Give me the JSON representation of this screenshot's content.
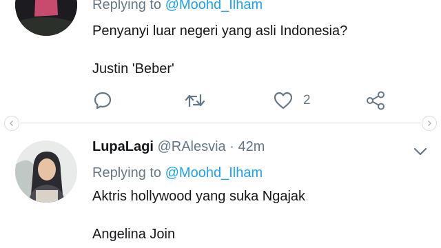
{
  "tweet_top": {
    "reply_prefix": "Replying to ",
    "reply_handle": "@Moohd_Ilham",
    "text_line1": "Penyanyi luar negeri yang asli Indonesia?",
    "text_line2": "Justin 'Beber'",
    "actions": {
      "reply_icon": "comment-icon",
      "retweet_icon": "retweet-icon",
      "like_icon": "heart-icon",
      "like_count": "2",
      "share_icon": "share-icon"
    }
  },
  "divider": {
    "left_icon": "chevron-left-icon",
    "right_icon": "chevron-right-icon"
  },
  "tweet_bottom": {
    "display_name": "LupaLagi",
    "username": "@RAlesvia",
    "separator": " · ",
    "time": "42m",
    "menu_icon": "chevron-down-icon",
    "reply_prefix": "Replying to ",
    "reply_handle": "@Moohd_Ilham",
    "text_line1": "Aktris hollywood yang suka Ngajak",
    "text_line2": "Angelina Join"
  },
  "colors": {
    "text_primary": "#14171a",
    "text_secondary": "#657786",
    "link": "#1da1f2",
    "divider": "#d7dde2"
  }
}
